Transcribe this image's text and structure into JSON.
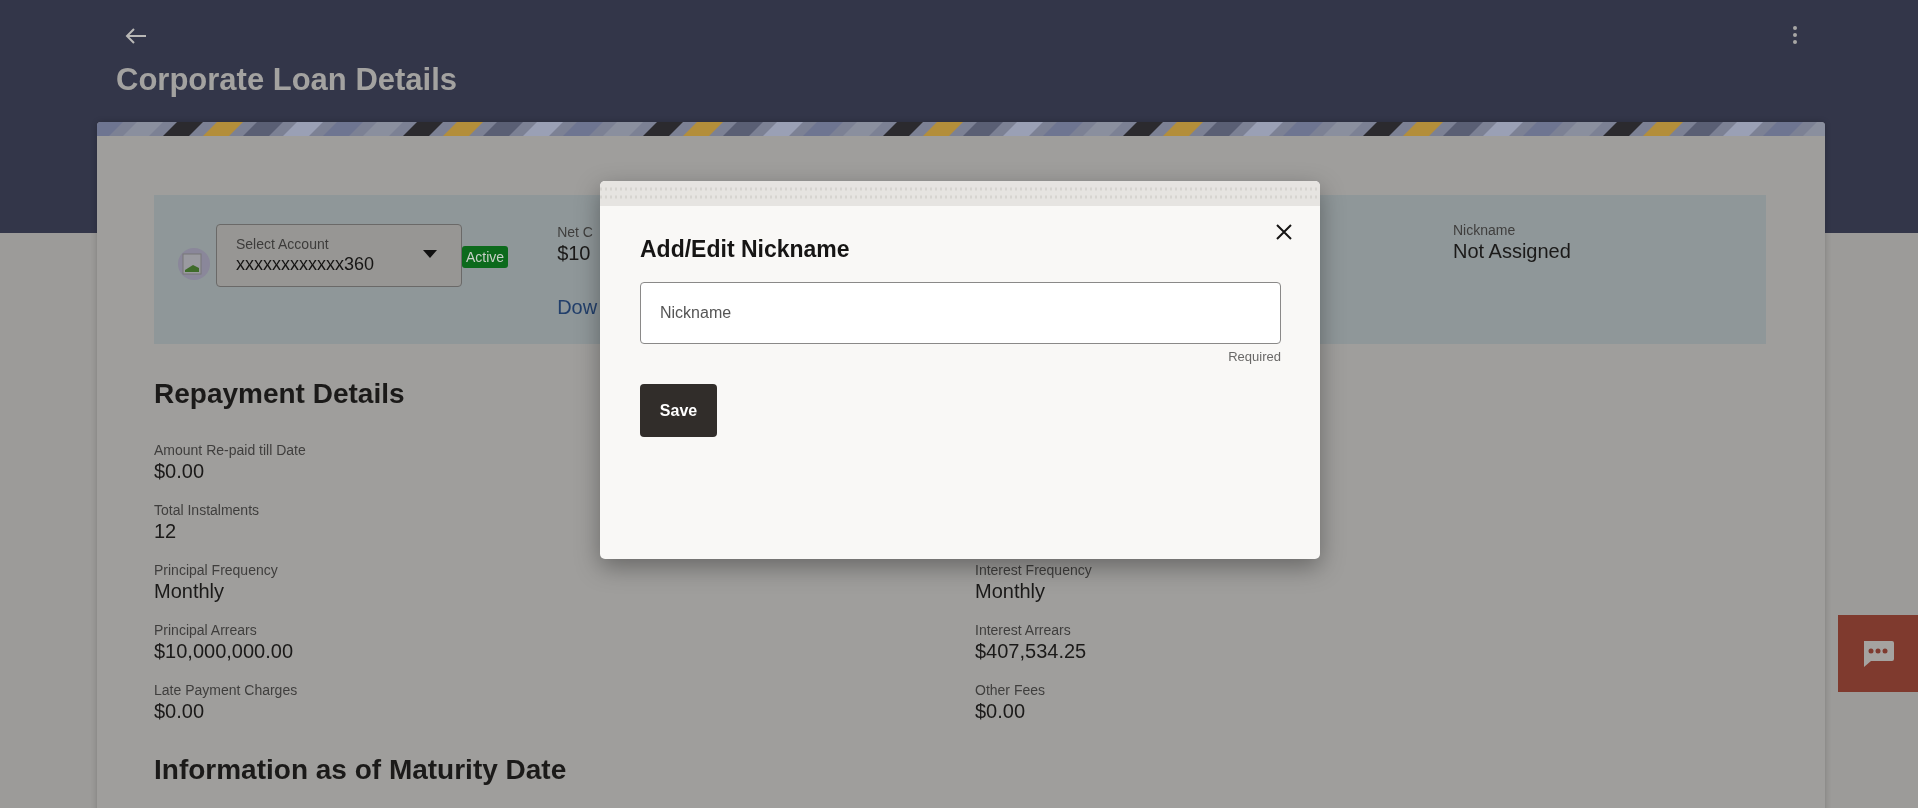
{
  "header": {
    "title": "Corporate Loan Details"
  },
  "account": {
    "label": "Select Account",
    "value": "xxxxxxxxxxxx360",
    "status": "Active"
  },
  "summary": {
    "label": "Net C",
    "value": "$10",
    "link": "Dow"
  },
  "nickname": {
    "label": "Nickname",
    "value": "Not Assigned"
  },
  "repayment": {
    "title": "Repayment Details",
    "left": [
      {
        "label": "Amount Re-paid till Date",
        "value": "$0.00"
      },
      {
        "label": "Total Instalments",
        "value": "12"
      },
      {
        "label": "Principal Frequency",
        "value": "Monthly"
      },
      {
        "label": "Principal Arrears",
        "value": "$10,000,000.00"
      },
      {
        "label": "Late Payment Charges",
        "value": "$0.00"
      }
    ],
    "right": [
      {
        "label": "Interest Frequency",
        "value": "Monthly"
      },
      {
        "label": "Interest Arrears",
        "value": "$407,534.25"
      },
      {
        "label": "Other Fees",
        "value": "$0.00"
      }
    ]
  },
  "maturity": {
    "title": "Information as of Maturity Date"
  },
  "dialog": {
    "title": "Add/Edit Nickname",
    "field": {
      "placeholder": "Nickname",
      "hint": "Required"
    },
    "button": "Save"
  }
}
